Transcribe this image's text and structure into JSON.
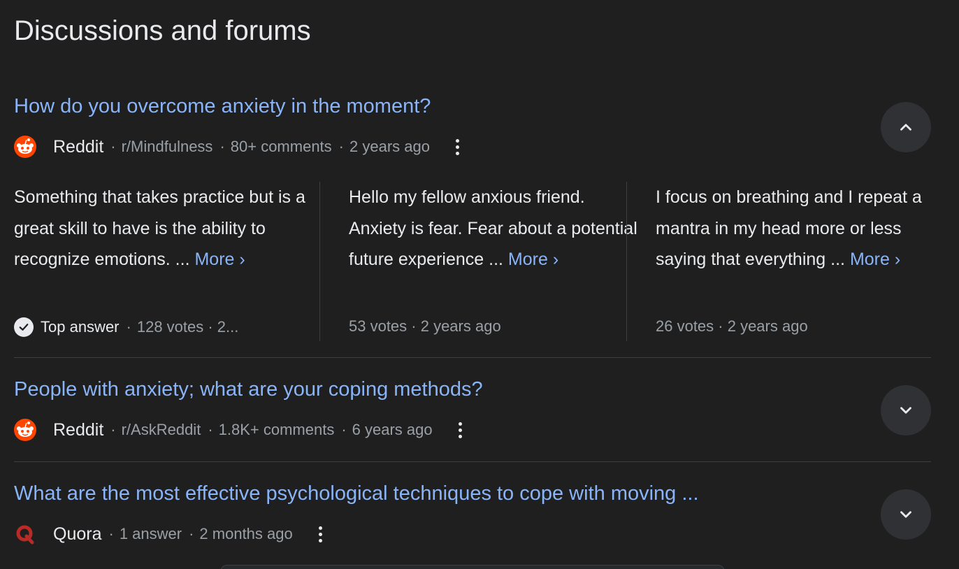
{
  "section": {
    "title": "Discussions and forums"
  },
  "threads": [
    {
      "title": "How do you overcome anxiety in the moment?",
      "source": "Reddit",
      "meta": [
        "r/Mindfulness",
        "80+ comments",
        "2 years ago"
      ],
      "expanded": true,
      "answers": [
        {
          "text": "Something that takes practice but is a great skill to have is the ability to recognize emotions. ...",
          "more": "More ›",
          "top_label": "Top answer",
          "meta": "128 votes · 2..."
        },
        {
          "text": "Hello my fellow anxious friend. Anxiety is fear. Fear about a potential future experience ...",
          "more": "More ›",
          "meta": "53 votes · 2 years ago"
        },
        {
          "text": "I focus on breathing and I repeat a mantra in my head more or less saying that everything ...",
          "more": "More ›",
          "meta": "26 votes · 2 years ago"
        }
      ]
    },
    {
      "title": "People with anxiety; what are your coping methods?",
      "source": "Reddit",
      "meta": [
        "r/AskReddit",
        "1.8K+ comments",
        "6 years ago"
      ],
      "expanded": false
    },
    {
      "title": "What are the most effective psychological techniques to cope with moving ...",
      "source": "Quora",
      "meta": [
        "1 answer",
        "2 months ago"
      ],
      "expanded": false
    }
  ],
  "icons": {
    "reddit": "reddit-logo-icon",
    "quora": "quora-logo-icon",
    "more_options": "more-vert-icon",
    "collapse": "chevron-up-icon",
    "expand": "chevron-down-icon",
    "top_answer": "check-circle-icon"
  },
  "colors": {
    "background": "#1f1f1f",
    "link": "#8ab4f8",
    "reddit": "#ff4500",
    "quora": "#b92b27"
  }
}
